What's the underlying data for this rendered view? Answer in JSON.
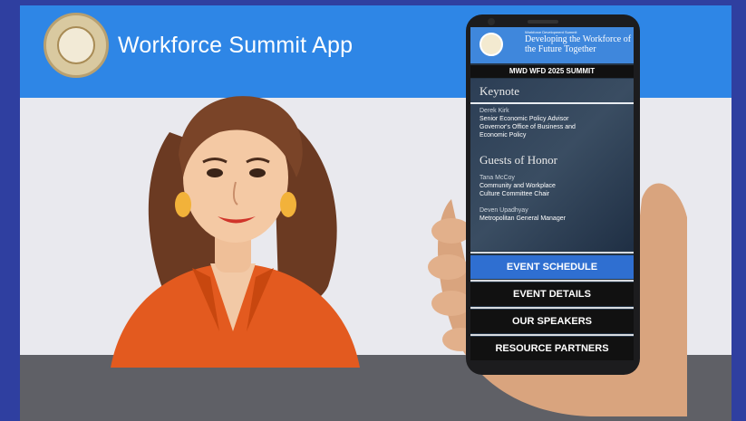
{
  "app": {
    "title": "Workforce Summit App"
  },
  "phone": {
    "header_small": "Workforce Development Summit",
    "header_title": "Developing the Workforce of the Future Together",
    "banner": "MWD WFD 2025 SUMMIT",
    "keynote": {
      "heading": "Keynote",
      "name": "Derek Kirk",
      "role_line1": "Senior Economic Policy Advisor",
      "role_line2": "Governor's Office of Business and",
      "role_line3": "Economic Policy"
    },
    "guests": {
      "heading": "Guests of Honor",
      "guest1_name": "Tana McCoy",
      "guest1_line1": "Community and Workplace",
      "guest1_line2": "Culture Committee Chair",
      "guest2_name": "Deven Upadhyay",
      "guest2_line1": "Metropolitan General Manager"
    },
    "menu": [
      {
        "label": "EVENT SCHEDULE"
      },
      {
        "label": "EVENT DETAILS"
      },
      {
        "label": "OUR SPEAKERS"
      },
      {
        "label": "RESOURCE PARTNERS"
      }
    ]
  },
  "colors": {
    "brand_blue": "#2e86e6",
    "frame_blue": "#2f3fa0",
    "menu_active": "#2f6fd1"
  }
}
